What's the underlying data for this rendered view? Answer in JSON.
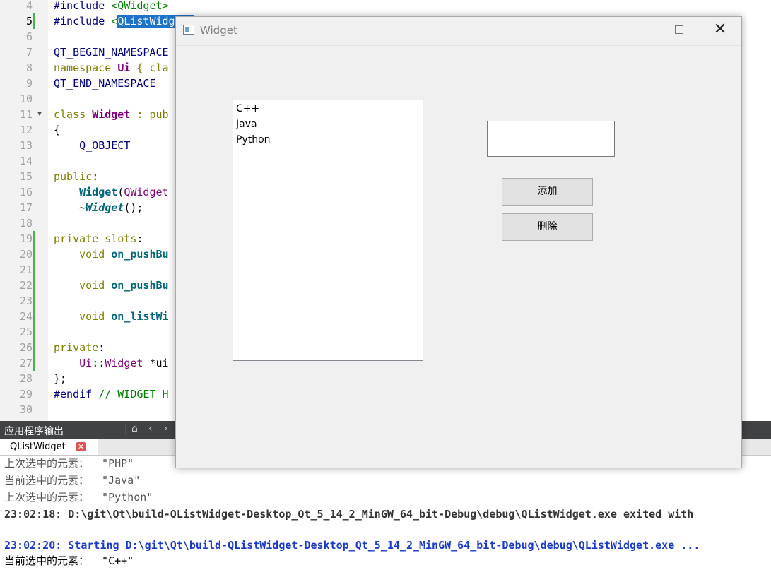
{
  "editor": {
    "lines": [
      {
        "num": "4",
        "current": false
      },
      {
        "num": "5",
        "current": true
      },
      {
        "num": "6",
        "current": false
      },
      {
        "num": "7",
        "current": false
      },
      {
        "num": "8",
        "current": false
      },
      {
        "num": "9",
        "current": false
      },
      {
        "num": "10",
        "current": false
      },
      {
        "num": "11",
        "current": false
      },
      {
        "num": "12",
        "current": false
      },
      {
        "num": "13",
        "current": false
      },
      {
        "num": "14",
        "current": false
      },
      {
        "num": "15",
        "current": false
      },
      {
        "num": "16",
        "current": false
      },
      {
        "num": "17",
        "current": false
      },
      {
        "num": "18",
        "current": false
      },
      {
        "num": "19",
        "current": false
      },
      {
        "num": "20",
        "current": false
      },
      {
        "num": "21",
        "current": false
      },
      {
        "num": "22",
        "current": false
      },
      {
        "num": "23",
        "current": false
      },
      {
        "num": "24",
        "current": false
      },
      {
        "num": "25",
        "current": false
      },
      {
        "num": "26",
        "current": false
      },
      {
        "num": "27",
        "current": false
      },
      {
        "num": "28",
        "current": false
      },
      {
        "num": "29",
        "current": false
      },
      {
        "num": "30",
        "current": false
      }
    ],
    "code": {
      "l4_a": "#include ",
      "l4_b": "<QWidget>",
      "l5_a": "#include ",
      "l5_b": "<",
      "l5_sel": "QListWidget>",
      "l7": "QT_BEGIN_NAMESPACE",
      "l8_a": "namespace ",
      "l8_b": "Ui",
      "l8_c": " { cla",
      "l9": "QT_END_NAMESPACE",
      "l11_a": "class ",
      "l11_b": "Widget",
      "l11_c": " : pub",
      "l12": "{",
      "l13": "    Q_OBJECT",
      "l15_a": "public",
      "l15_b": ":",
      "l16_a": "    ",
      "l16_b": "Widget",
      "l16_c": "(",
      "l16_d": "QWidget",
      "l17_a": "    ~",
      "l17_b": "Widget",
      "l17_c": "();",
      "l19_a": "private slots",
      "l19_b": ":",
      "l20_a": "    void ",
      "l20_b": "on_pushBu",
      "l22_a": "    void ",
      "l22_b": "on_pushBu",
      "l24_a": "    void ",
      "l24_b": "on_listWi",
      "l26_a": "private",
      "l26_b": ":",
      "l27_a": "    ",
      "l27_b": "Ui",
      "l27_c": "::",
      "l27_d": "Widget",
      "l27_e": " *ui",
      "l28": "};",
      "l29_a": "#endif ",
      "l29_b": "// WIDGET_H"
    }
  },
  "output_pane": {
    "title": "应用程序输出",
    "tab_label": "QListWidget",
    "lines": [
      "上次选中的元素：  \"PHP\"",
      "当前选中的元素：  \"Java\"",
      "上次选中的元素：  \"Python\"",
      "23:02:18: D:\\git\\Qt\\build-QListWidget-Desktop_Qt_5_14_2_MinGW_64_bit-Debug\\debug\\QListWidget.exe exited with",
      "",
      "23:02:20: Starting D:\\git\\Qt\\build-QListWidget-Desktop_Qt_5_14_2_MinGW_64_bit-Debug\\debug\\QListWidget.exe ...",
      "当前选中的元素：  \"C++\""
    ]
  },
  "app_window": {
    "title": "Widget",
    "close_glyph": "✕",
    "list_items": [
      "C++",
      "Java",
      "Python"
    ],
    "input_value": "",
    "add_button": "添加",
    "delete_button": "删除"
  }
}
